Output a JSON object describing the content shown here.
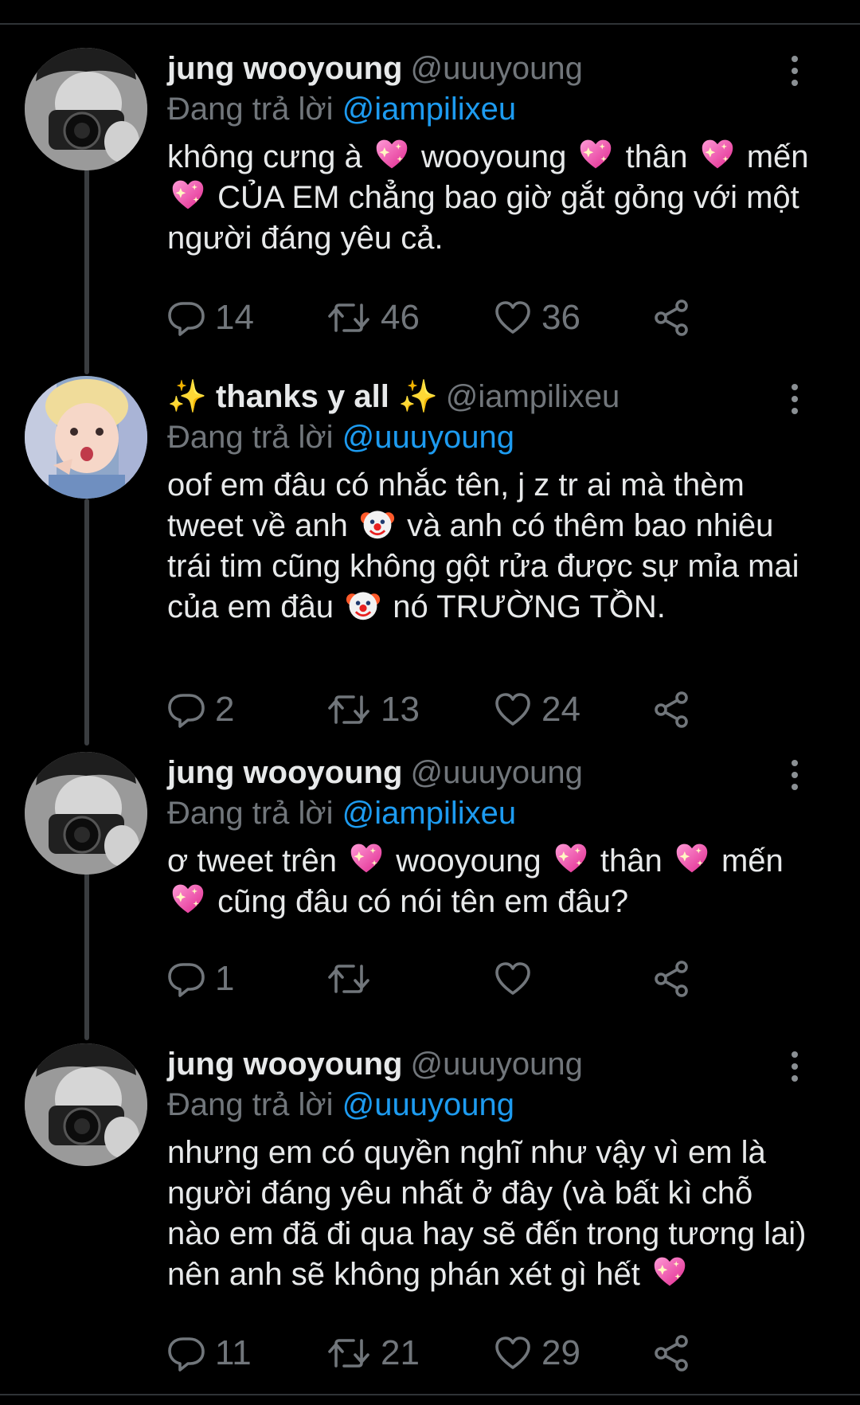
{
  "colors": {
    "background": "#000000",
    "text": "#e7e9ea",
    "secondary": "#71767b",
    "link": "#1d9bf0",
    "divider": "#2f3336"
  },
  "tweets": [
    {
      "display_name": "jung wooyoung",
      "handle": "@uuuyoung",
      "reply_prefix": "Đang trả lời",
      "reply_to": "@iampilixeu",
      "text_parts": [
        "không cưng à",
        "wooyoung",
        "thân",
        "mến",
        "CỦA EM chẳng bao giờ gắt gỏng với một người đáng yêu cả."
      ],
      "counts": {
        "reply": "14",
        "retweet": "46",
        "like": "36"
      },
      "avatar_icon": "avatar-camera-bw"
    },
    {
      "display_name": "thanks y all",
      "display_name_decoration": "✨",
      "handle": "@iampilixeu",
      "reply_prefix": "Đang trả lời",
      "reply_to": "@uuuyoung",
      "text_parts": [
        "oof em đâu có nhắc tên, j z tr ai mà thèm tweet về anh",
        "và anh có thêm bao nhiêu trái tim cũng không gột rửa được sự mỉa mai của em đâu",
        "nó TRƯỜNG TỒN."
      ],
      "counts": {
        "reply": "2",
        "retweet": "13",
        "like": "24"
      },
      "avatar_icon": "avatar-blonde-face"
    },
    {
      "display_name": "jung wooyoung",
      "handle": "@uuuyoung",
      "reply_prefix": "Đang trả lời",
      "reply_to": "@iampilixeu",
      "text_parts": [
        "ơ tweet trên",
        "wooyoung",
        "thân",
        "mến",
        "cũng đâu có nói tên em đâu?"
      ],
      "counts": {
        "reply": "1",
        "retweet": "",
        "like": ""
      },
      "avatar_icon": "avatar-camera-bw"
    },
    {
      "display_name": "jung wooyoung",
      "handle": "@uuuyoung",
      "reply_prefix": "Đang trả lời",
      "reply_to": "@uuuyoung",
      "text_parts": [
        "nhưng em có quyền nghĩ như vậy vì em là người đáng yêu nhất ở đây (và bất kì chỗ nào em đã đi qua hay sẽ đến trong tương lai) nên anh sẽ không phán xét gì hết"
      ],
      "counts": {
        "reply": "11",
        "retweet": "21",
        "like": "29"
      },
      "avatar_icon": "avatar-camera-bw"
    }
  ],
  "icons": {
    "reply": "reply-bubble-icon",
    "retweet": "retweet-icon",
    "like": "heart-outline-icon",
    "share": "share-icon",
    "menu": "more-vertical-icon",
    "emoji_heart": "sparkling-heart-emoji",
    "emoji_clown": "clown-face-emoji"
  }
}
